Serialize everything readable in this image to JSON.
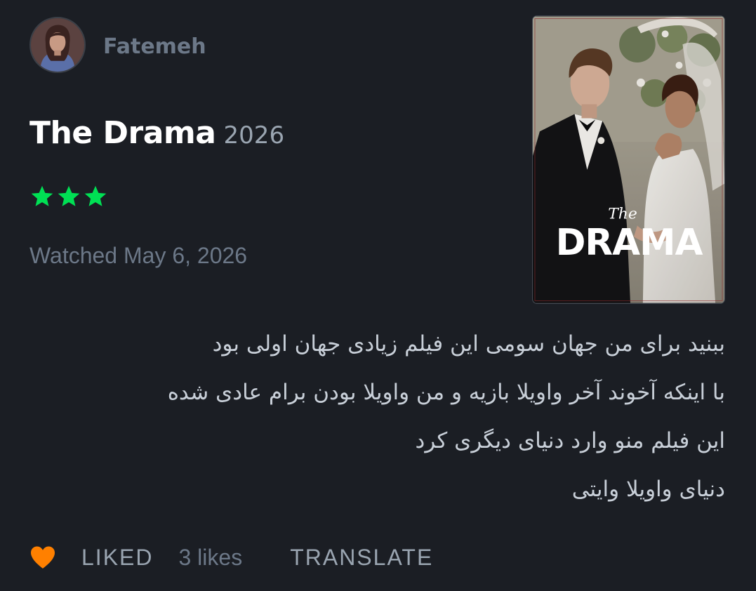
{
  "user": {
    "name": "Fatemeh",
    "avatar_icon": "user-avatar-photo"
  },
  "film": {
    "title": "The Drama",
    "year": "2026",
    "rating_stars": 3,
    "star_color": "#00e054",
    "poster": {
      "title_small": "The",
      "title_large": "DRAMA"
    }
  },
  "watched_text": "Watched May 6, 2026",
  "review": {
    "lines": [
      "ببنید برای من جهان سومی این فیلم زیادی جهان اولی بود",
      "با اینکه آخوند آخر واویلا بازیه و من واویلا بودن برام عادی شده",
      "این فیلم منو وارد دنیای دیگری کرد",
      "دنیای واویلا وایتی"
    ]
  },
  "actions": {
    "heart_icon": "heart-icon",
    "heart_color": "#ff8000",
    "liked_label": "LIKED",
    "likes_count": "3 likes",
    "translate_label": "TRANSLATE"
  }
}
